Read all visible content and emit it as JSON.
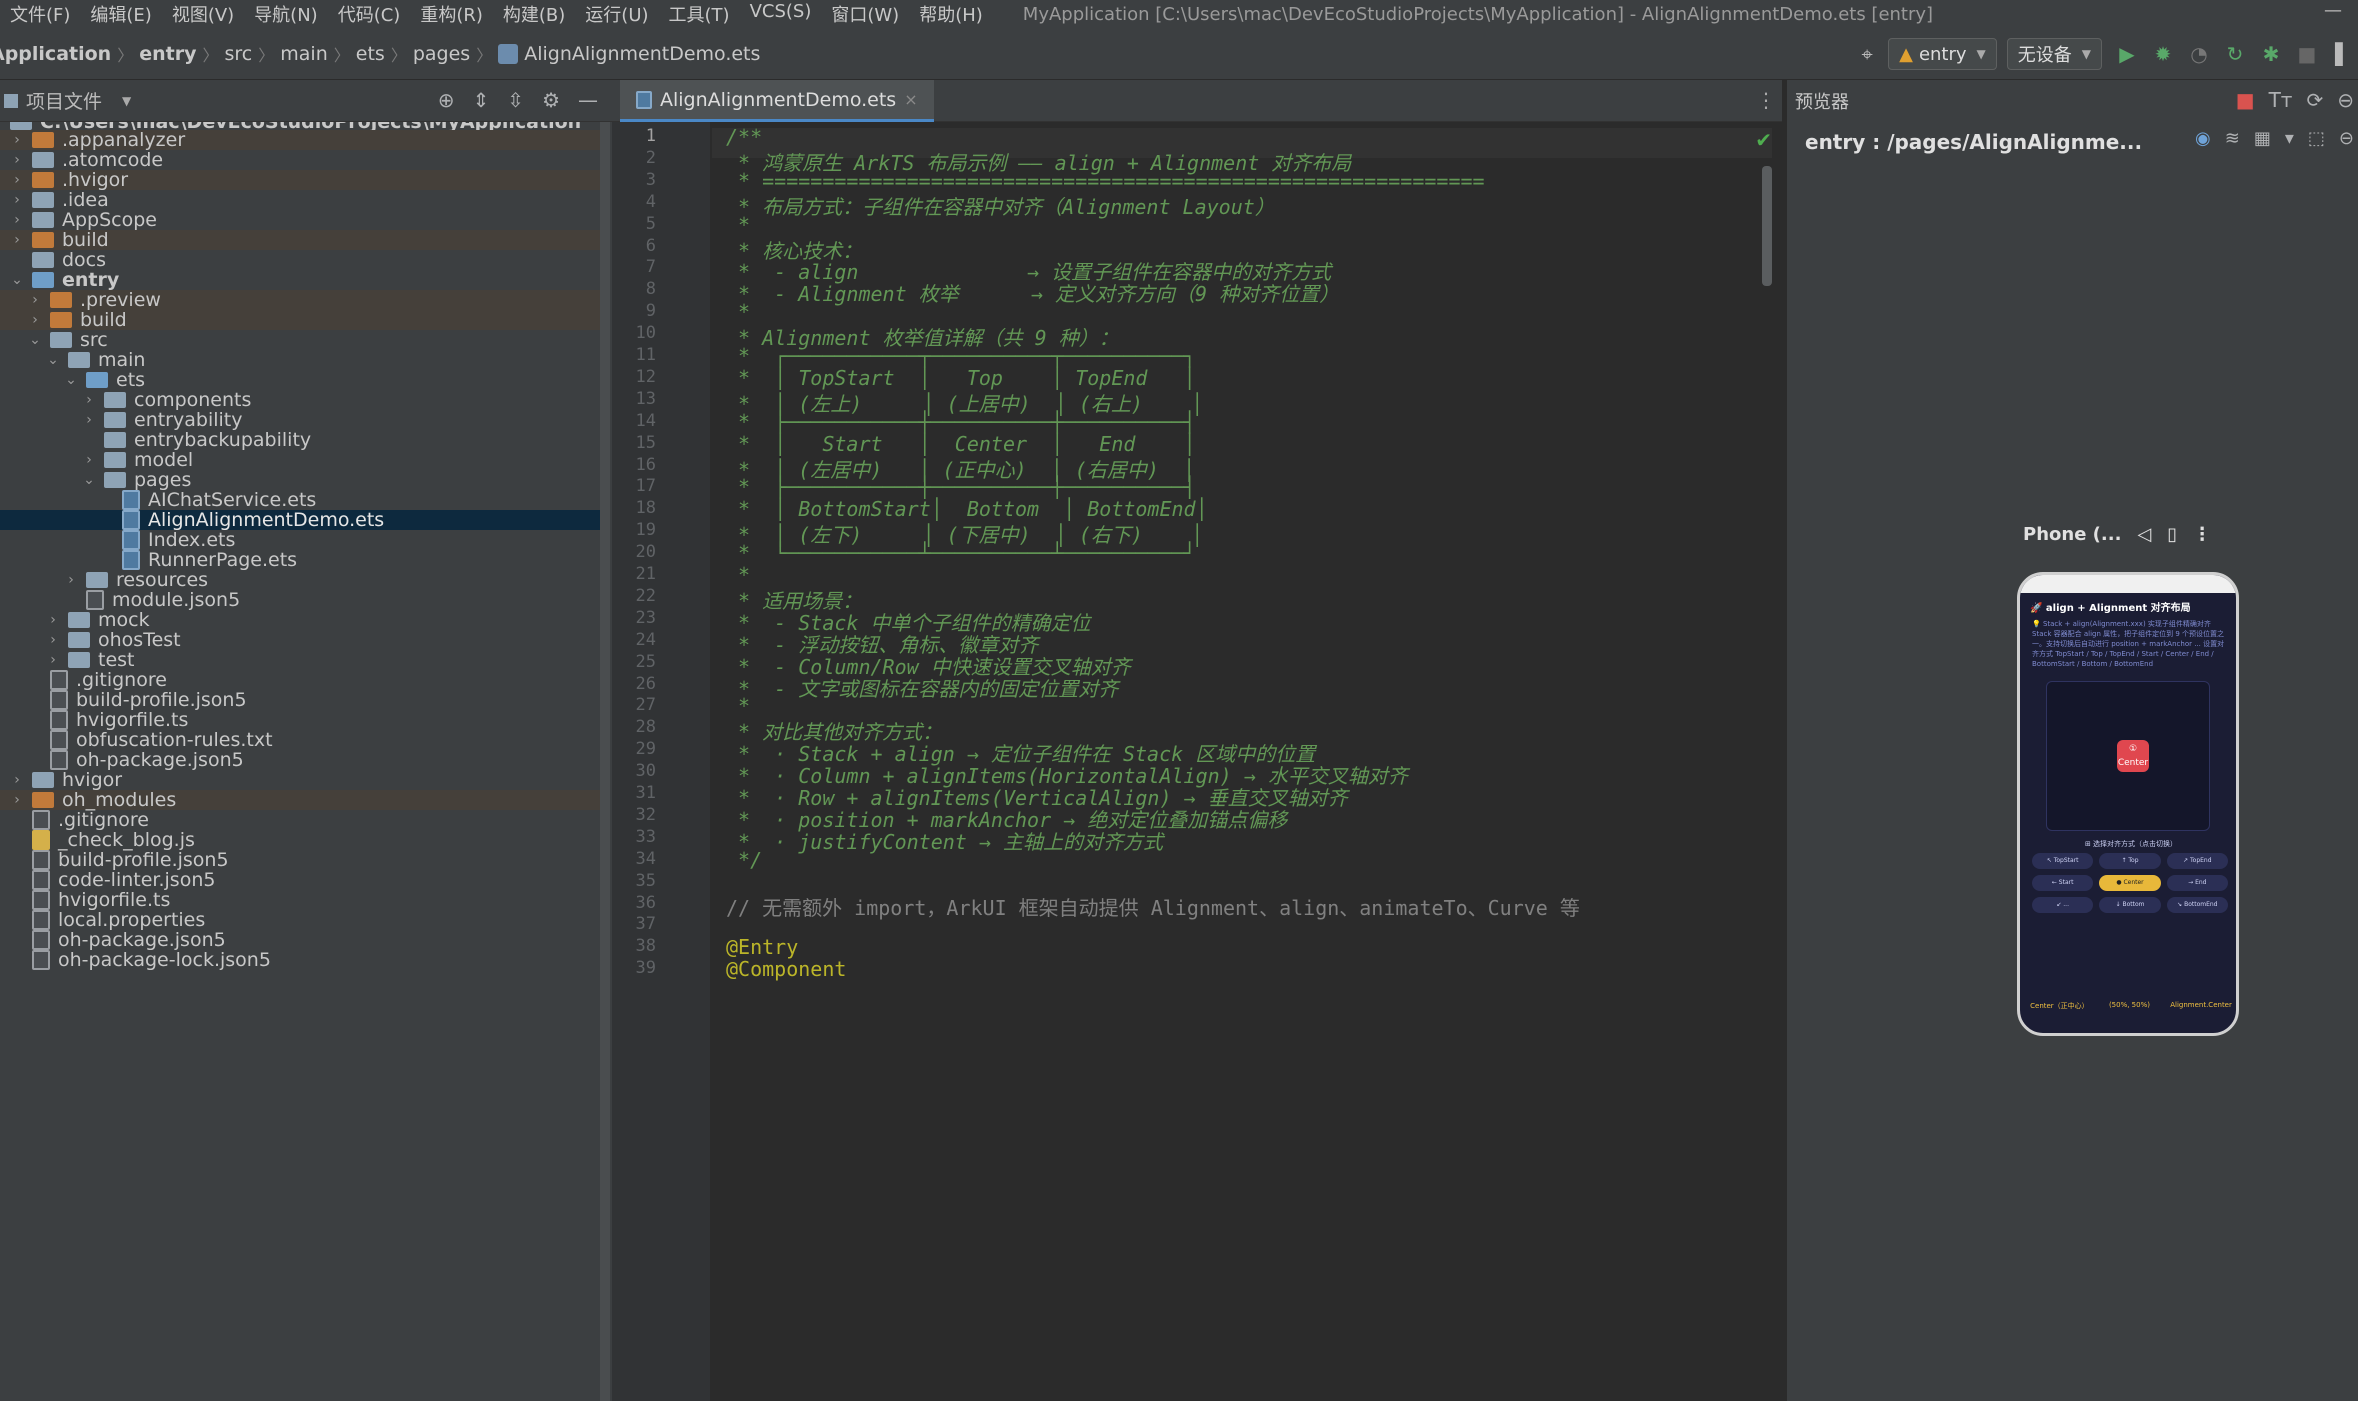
{
  "menubar": {
    "items": [
      "文件(F)",
      "编辑(E)",
      "视图(V)",
      "导航(N)",
      "代码(C)",
      "重构(R)",
      "构建(B)",
      "运行(U)",
      "工具(T)",
      "VCS(S)",
      "窗口(W)",
      "帮助(H)"
    ],
    "window_title": "MyApplication [C:\\Users\\mac\\DevEcoStudioProjects\\MyApplication] - AlignAlignmentDemo.ets [entry]",
    "minimize": "—"
  },
  "navbar": {
    "crumbs": [
      "Application",
      "entry",
      "src",
      "main",
      "ets",
      "pages",
      "AlignAlignmentDemo.ets"
    ],
    "run_config": "entry",
    "device": "无设备"
  },
  "project": {
    "header_label": "项目文件",
    "root_path": "C:\\Users\\mac\\DevEcoStudioProjects\\MyApplication",
    "tree": [
      {
        "label": ".appanalyzer",
        "kind": "folder-o",
        "depth": 0,
        "chev": ">",
        "ex": true
      },
      {
        "label": ".atomcode",
        "kind": "folder-g",
        "depth": 0,
        "chev": ">"
      },
      {
        "label": ".hvigor",
        "kind": "folder-o",
        "depth": 0,
        "chev": ">",
        "ex": true
      },
      {
        "label": ".idea",
        "kind": "folder-g",
        "depth": 0,
        "chev": ">"
      },
      {
        "label": "AppScope",
        "kind": "folder-g",
        "depth": 0,
        "chev": ">"
      },
      {
        "label": "build",
        "kind": "folder-o",
        "depth": 0,
        "chev": ">",
        "ex": true
      },
      {
        "label": "docs",
        "kind": "folder-g",
        "depth": 0,
        "chev": ""
      },
      {
        "label": "entry",
        "kind": "folder-b",
        "depth": 0,
        "chev": "v",
        "bold": true
      },
      {
        "label": ".preview",
        "kind": "folder-o",
        "depth": 1,
        "chev": ">",
        "ex": true
      },
      {
        "label": "build",
        "kind": "folder-o",
        "depth": 1,
        "chev": ">",
        "ex": true
      },
      {
        "label": "src",
        "kind": "folder-g",
        "depth": 1,
        "chev": "v"
      },
      {
        "label": "main",
        "kind": "folder-g",
        "depth": 2,
        "chev": "v"
      },
      {
        "label": "ets",
        "kind": "folder-b",
        "depth": 3,
        "chev": "v"
      },
      {
        "label": "components",
        "kind": "folder-g",
        "depth": 4,
        "chev": ">"
      },
      {
        "label": "entryability",
        "kind": "folder-g",
        "depth": 4,
        "chev": ">"
      },
      {
        "label": "entrybackupability",
        "kind": "folder-g",
        "depth": 4,
        "chev": ""
      },
      {
        "label": "model",
        "kind": "folder-g",
        "depth": 4,
        "chev": ">"
      },
      {
        "label": "pages",
        "kind": "folder-g",
        "depth": 4,
        "chev": "v"
      },
      {
        "label": "AIChatService.ets",
        "kind": "ets",
        "depth": 5,
        "chev": ""
      },
      {
        "label": "AlignAlignmentDemo.ets",
        "kind": "ets",
        "depth": 5,
        "chev": "",
        "sel": true
      },
      {
        "label": "Index.ets",
        "kind": "ets",
        "depth": 5,
        "chev": ""
      },
      {
        "label": "RunnerPage.ets",
        "kind": "ets",
        "depth": 5,
        "chev": ""
      },
      {
        "label": "resources",
        "kind": "folder-g",
        "depth": 3,
        "chev": ">"
      },
      {
        "label": "module.json5",
        "kind": "file",
        "depth": 3,
        "chev": ""
      },
      {
        "label": "mock",
        "kind": "folder-g",
        "depth": 2,
        "chev": ">"
      },
      {
        "label": "ohosTest",
        "kind": "folder-g",
        "depth": 2,
        "chev": ">"
      },
      {
        "label": "test",
        "kind": "folder-g",
        "depth": 2,
        "chev": ">"
      },
      {
        "label": ".gitignore",
        "kind": "file",
        "depth": 1,
        "chev": ""
      },
      {
        "label": "build-profile.json5",
        "kind": "file",
        "depth": 1,
        "chev": ""
      },
      {
        "label": "hvigorfile.ts",
        "kind": "file",
        "depth": 1,
        "chev": ""
      },
      {
        "label": "obfuscation-rules.txt",
        "kind": "file",
        "depth": 1,
        "chev": ""
      },
      {
        "label": "oh-package.json5",
        "kind": "file",
        "depth": 1,
        "chev": ""
      },
      {
        "label": "hvigor",
        "kind": "folder-g",
        "depth": 0,
        "chev": ">"
      },
      {
        "label": "oh_modules",
        "kind": "folder-o",
        "depth": 0,
        "chev": ">",
        "ex": true
      },
      {
        "label": ".gitignore",
        "kind": "file",
        "depth": 0,
        "chev": ""
      },
      {
        "label": "_check_blog.js",
        "kind": "js",
        "depth": 0,
        "chev": ""
      },
      {
        "label": "build-profile.json5",
        "kind": "file",
        "depth": 0,
        "chev": ""
      },
      {
        "label": "code-linter.json5",
        "kind": "file",
        "depth": 0,
        "chev": ""
      },
      {
        "label": "hvigorfile.ts",
        "kind": "file",
        "depth": 0,
        "chev": ""
      },
      {
        "label": "local.properties",
        "kind": "file",
        "depth": 0,
        "chev": ""
      },
      {
        "label": "oh-package.json5",
        "kind": "file",
        "depth": 0,
        "chev": ""
      },
      {
        "label": "oh-package-lock.json5",
        "kind": "file",
        "depth": 0,
        "chev": ""
      }
    ]
  },
  "editor": {
    "tab_label": "AlignAlignmentDemo.ets",
    "lines": [
      {
        "n": "1",
        "t": "/**",
        "s": "cm"
      },
      {
        "n": "2",
        "t": " * 鸿蒙原生 ArkTS 布局示例 —— align + Alignment 对齐布局",
        "s": "cm"
      },
      {
        "n": "3",
        "t": " * ============================================================",
        "s": "cm"
      },
      {
        "n": "4",
        "t": " * 布局方式：子组件在容器中对齐（Alignment Layout）",
        "s": "cm"
      },
      {
        "n": "5",
        "t": " *",
        "s": "cm"
      },
      {
        "n": "6",
        "t": " * 核心技术：",
        "s": "cm"
      },
      {
        "n": "7",
        "t": " *  - align              → 设置子组件在容器中的对齐方式",
        "s": "cm"
      },
      {
        "n": "8",
        "t": " *  - Alignment 枚举      → 定义对齐方向（9 种对齐位置）",
        "s": "cm"
      },
      {
        "n": "9",
        "t": " *",
        "s": "cm"
      },
      {
        "n": "10",
        "t": " * Alignment 枚举值详解（共 9 种）：",
        "s": "cm"
      },
      {
        "n": "11",
        "t": " *  ┌───────────┬──────────┬──────────┐",
        "s": "cm"
      },
      {
        "n": "12",
        "t": " *  │ TopStart  │   Top    │ TopEnd   │",
        "s": "cm"
      },
      {
        "n": "13",
        "t": " *  │ (左上)     │ (上居中)  │ (右上)    │",
        "s": "cm"
      },
      {
        "n": "14",
        "t": " *  ├───────────┼──────────┼──────────┤",
        "s": "cm"
      },
      {
        "n": "15",
        "t": " *  │   Start   │  Center  │   End    │",
        "s": "cm"
      },
      {
        "n": "16",
        "t": " *  │ (左居中)   │ (正中心)  │ (右居中)  │",
        "s": "cm"
      },
      {
        "n": "17",
        "t": " *  ├───────────┼──────────┼──────────┤",
        "s": "cm"
      },
      {
        "n": "18",
        "t": " *  │ BottomStart│  Bottom  │ BottomEnd│",
        "s": "cm"
      },
      {
        "n": "19",
        "t": " *  │ (左下)     │ (下居中)  │ (右下)    │",
        "s": "cm"
      },
      {
        "n": "20",
        "t": " *  └───────────┴──────────┴──────────┘",
        "s": "cm"
      },
      {
        "n": "21",
        "t": " *",
        "s": "cm"
      },
      {
        "n": "22",
        "t": " * 适用场景：",
        "s": "cm"
      },
      {
        "n": "23",
        "t": " *  - Stack 中单个子组件的精确定位",
        "s": "cm"
      },
      {
        "n": "24",
        "t": " *  - 浮动按钮、角标、徽章对齐",
        "s": "cm"
      },
      {
        "n": "25",
        "t": " *  - Column/Row 中快速设置交叉轴对齐",
        "s": "cm"
      },
      {
        "n": "26",
        "t": " *  - 文字或图标在容器内的固定位置对齐",
        "s": "cm"
      },
      {
        "n": "27",
        "t": " *",
        "s": "cm"
      },
      {
        "n": "28",
        "t": " * 对比其他对齐方式：",
        "s": "cm"
      },
      {
        "n": "29",
        "t": " *  · Stack + align → 定位子组件在 Stack 区域中的位置",
        "s": "cm"
      },
      {
        "n": "30",
        "t": " *  · Column + alignItems(HorizontalAlign) → 水平交叉轴对齐",
        "s": "cm"
      },
      {
        "n": "31",
        "t": " *  · Row + alignItems(VerticalAlign) → 垂直交叉轴对齐",
        "s": "cm"
      },
      {
        "n": "32",
        "t": " *  · position + markAnchor → 绝对定位叠加锚点偏移",
        "s": "cm"
      },
      {
        "n": "33",
        "t": " *  · justifyContent → 主轴上的对齐方式",
        "s": "cm"
      },
      {
        "n": "34",
        "t": " */",
        "s": "cm"
      },
      {
        "n": "35",
        "t": "",
        "s": "cm"
      },
      {
        "n": "36",
        "t": "// 无需额外 import，ArkUI 框架自动提供 Alignment、align、animateTo、Curve 等",
        "s": "plain"
      },
      {
        "n": "37",
        "t": "",
        "s": "cm"
      },
      {
        "n": "38",
        "t": "@Entry",
        "s": "ann"
      },
      {
        "n": "39",
        "t": "@Component",
        "s": "ann"
      }
    ]
  },
  "previewer": {
    "title": "预览器",
    "path": "entry : /pages/AlignAlignme...",
    "device": "Phone (...",
    "app_title": "🚀 align + Alignment 对齐布局",
    "app_desc": "💡 Stack + align(Alignment.xxx) 实现子组件精确对齐 Stack 容器配合 align 属性，把子组件定位到 9 个预设位置之一。支持切换后自动进行 position + markAnchor ... 设置对齐方式 TopStart / Top / TopEnd / Start / Center / End / BottomStart / Bottom / BottomEnd",
    "chip_label": "① Center",
    "grid_title": "⊞ 选择对齐方式（点击切换）",
    "grid": [
      "↖ TopStart",
      "↑ Top",
      "↗ TopEnd",
      "← Start",
      "● Center",
      "→ End",
      "↙ ...",
      "↓ Bottom",
      "↘ BottomEnd"
    ],
    "footer": [
      "Center（正中心）",
      "(50%, 50%)",
      "Alignment.Center"
    ]
  }
}
